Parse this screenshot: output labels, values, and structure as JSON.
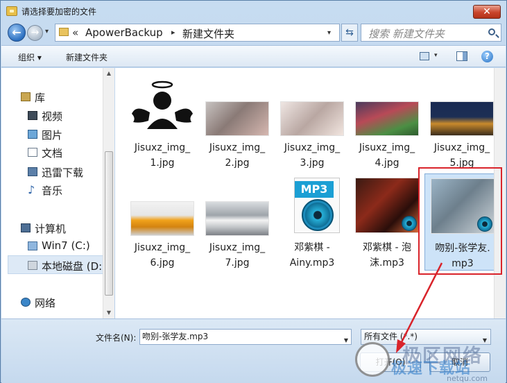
{
  "window": {
    "title": "请选择要加密的文件",
    "close_glyph": "✕"
  },
  "address": {
    "breadcrumb_chevron": "«",
    "crumbs": [
      "ApowerBackup",
      "新建文件夹"
    ],
    "separator": "▸",
    "search_placeholder": "搜索 新建文件夹"
  },
  "toolbar": {
    "organize": "组织 ▾",
    "new_folder": "新建文件夹",
    "help_glyph": "?"
  },
  "nav": {
    "items": [
      {
        "label": "库",
        "icon": "library-icon"
      },
      {
        "label": "视频",
        "icon": "video-icon"
      },
      {
        "label": "图片",
        "icon": "picture-icon"
      },
      {
        "label": "文档",
        "icon": "document-icon"
      },
      {
        "label": "迅雷下载",
        "icon": "download-icon"
      },
      {
        "label": "音乐",
        "icon": "music-icon"
      },
      {
        "label": "计算机",
        "icon": "computer-icon"
      },
      {
        "label": "Win7 (C:)",
        "icon": "windows-drive-icon"
      },
      {
        "label": "本地磁盘 (D:",
        "icon": "disk-icon"
      },
      {
        "label": "网络",
        "icon": "network-icon"
      }
    ]
  },
  "files": [
    {
      "name": "Jisuxz_img_\n1.jpg",
      "thumb": "angel-avatar"
    },
    {
      "name": "Jisuxz_img_\n2.jpg",
      "thumb": "photo"
    },
    {
      "name": "Jisuxz_img_\n3.jpg",
      "thumb": "photo"
    },
    {
      "name": "Jisuxz_img_\n4.jpg",
      "thumb": "photo"
    },
    {
      "name": "Jisuxz_img_\n5.jpg",
      "thumb": "photo"
    },
    {
      "name": "Jisuxz_img_\n6.jpg",
      "thumb": "photo"
    },
    {
      "name": "Jisuxz_img_\n7.jpg",
      "thumb": "photo"
    },
    {
      "name": "邓紫棋 -\nAiny.mp3",
      "thumb": "mp3-document"
    },
    {
      "name": "邓紫棋 - 泡\n沫.mp3",
      "thumb": "album"
    },
    {
      "name": "吻别-张学友.\nmp3",
      "thumb": "album",
      "selected": true
    }
  ],
  "mp3_label": "MP3",
  "bottom": {
    "filename_label": "文件名(N):",
    "filename_value": "吻别-张学友.mp3",
    "filetype_value": "所有文件 (*.*)",
    "open_label": "打开(O)",
    "cancel_label": "取消"
  },
  "watermark": {
    "line1": "极区网络",
    "line2": "极速下载站",
    "line3": "netqu.com"
  },
  "colors": {
    "highlight": "#d9242b",
    "accent": "#2b6fc0"
  }
}
